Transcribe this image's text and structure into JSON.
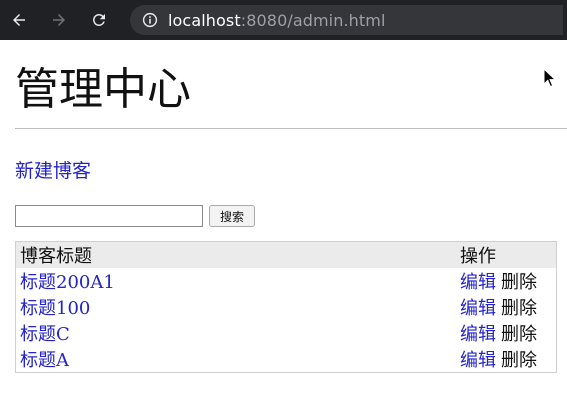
{
  "browser": {
    "url_host": "localhost",
    "url_rest": ":8080/admin.html",
    "icons": [
      "back-arrow-icon",
      "forward-arrow-icon",
      "reload-icon",
      "info-icon"
    ]
  },
  "page": {
    "title": "管理中心",
    "new_blog_link": "新建博客",
    "search": {
      "input_value": "",
      "button_label": "搜索"
    },
    "table": {
      "headers": [
        "博客标题",
        "操作"
      ],
      "rows": [
        {
          "title": "标题200A1",
          "edit": "编辑",
          "delete": "删除"
        },
        {
          "title": "标题100",
          "edit": "编辑",
          "delete": "删除"
        },
        {
          "title": "标题C",
          "edit": "编辑",
          "delete": "删除"
        },
        {
          "title": "标题A",
          "edit": "编辑",
          "delete": "删除"
        }
      ]
    }
  },
  "colors": {
    "link": "#2424c8",
    "chrome_bg": "#202124",
    "omnibox_bg": "#35363a",
    "header_bg": "#ebebeb"
  }
}
